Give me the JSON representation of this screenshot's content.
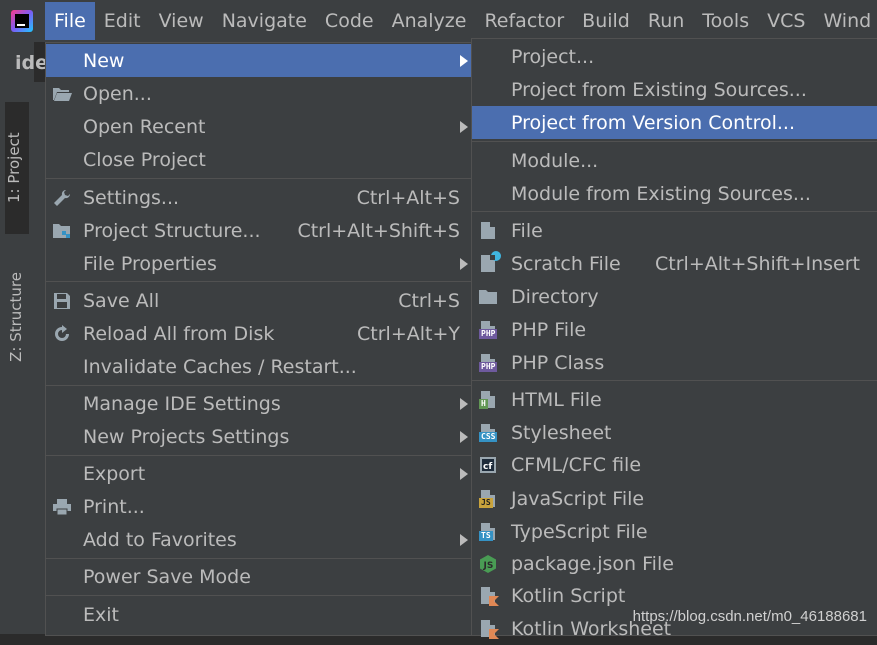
{
  "menubar": {
    "items": [
      {
        "label": "File"
      },
      {
        "label": "Edit"
      },
      {
        "label": "View"
      },
      {
        "label": "Navigate"
      },
      {
        "label": "Code"
      },
      {
        "label": "Analyze"
      },
      {
        "label": "Refactor"
      },
      {
        "label": "Build"
      },
      {
        "label": "Run"
      },
      {
        "label": "Tools"
      },
      {
        "label": "VCS"
      },
      {
        "label": "Wind"
      }
    ]
  },
  "ide": {
    "project_label": "ide",
    "tab_project": "1: Project",
    "tab_structure": "Z: Structure"
  },
  "file_menu": {
    "items": [
      {
        "label": "New"
      },
      {
        "label": "Open..."
      },
      {
        "label": "Open Recent"
      },
      {
        "label": "Close Project"
      },
      {
        "label": "Settings...",
        "shortcut": "Ctrl+Alt+S"
      },
      {
        "label": "Project Structure...",
        "shortcut": "Ctrl+Alt+Shift+S"
      },
      {
        "label": "File Properties"
      },
      {
        "label": "Save All",
        "shortcut": "Ctrl+S"
      },
      {
        "label": "Reload All from Disk",
        "shortcut": "Ctrl+Alt+Y"
      },
      {
        "label": "Invalidate Caches / Restart..."
      },
      {
        "label": "Manage IDE Settings"
      },
      {
        "label": "New Projects Settings"
      },
      {
        "label": "Export"
      },
      {
        "label": "Print..."
      },
      {
        "label": "Add to Favorites"
      },
      {
        "label": "Power Save Mode"
      },
      {
        "label": "Exit"
      }
    ]
  },
  "new_menu": {
    "items": [
      {
        "label": "Project..."
      },
      {
        "label": "Project from Existing Sources..."
      },
      {
        "label": "Project from Version Control..."
      },
      {
        "label": "Module..."
      },
      {
        "label": "Module from Existing Sources..."
      },
      {
        "label": "File"
      },
      {
        "label": "Scratch File",
        "shortcut": "Ctrl+Alt+Shift+Insert"
      },
      {
        "label": "Directory"
      },
      {
        "label": "PHP File"
      },
      {
        "label": "PHP Class"
      },
      {
        "label": "HTML File"
      },
      {
        "label": "Stylesheet"
      },
      {
        "label": "CFML/CFC file"
      },
      {
        "label": "JavaScript File"
      },
      {
        "label": "TypeScript File"
      },
      {
        "label": "package.json File"
      },
      {
        "label": "Kotlin Script"
      },
      {
        "label": "Kotlin Worksheet"
      }
    ]
  },
  "watermark": "https://blog.csdn.net/m0_46188681",
  "colors": {
    "menu_bg": "#3c3f41",
    "highlight": "#4b6eaf",
    "text": "#bbbbbb",
    "separator": "#515151"
  }
}
